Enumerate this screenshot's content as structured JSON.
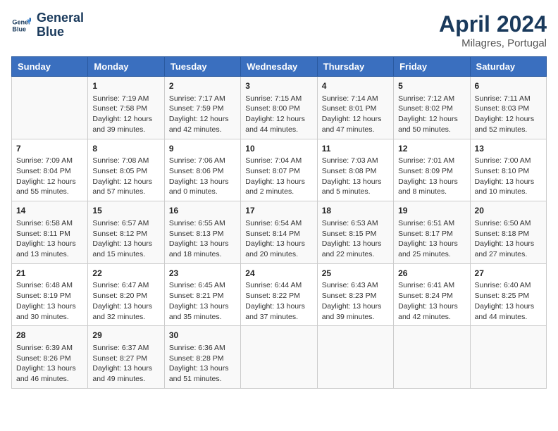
{
  "logo": {
    "line1": "General",
    "line2": "Blue"
  },
  "title": "April 2024",
  "subtitle": "Milagres, Portugal",
  "headers": [
    "Sunday",
    "Monday",
    "Tuesday",
    "Wednesday",
    "Thursday",
    "Friday",
    "Saturday"
  ],
  "weeks": [
    [
      {
        "day": "",
        "info": ""
      },
      {
        "day": "1",
        "info": "Sunrise: 7:19 AM\nSunset: 7:58 PM\nDaylight: 12 hours\nand 39 minutes."
      },
      {
        "day": "2",
        "info": "Sunrise: 7:17 AM\nSunset: 7:59 PM\nDaylight: 12 hours\nand 42 minutes."
      },
      {
        "day": "3",
        "info": "Sunrise: 7:15 AM\nSunset: 8:00 PM\nDaylight: 12 hours\nand 44 minutes."
      },
      {
        "day": "4",
        "info": "Sunrise: 7:14 AM\nSunset: 8:01 PM\nDaylight: 12 hours\nand 47 minutes."
      },
      {
        "day": "5",
        "info": "Sunrise: 7:12 AM\nSunset: 8:02 PM\nDaylight: 12 hours\nand 50 minutes."
      },
      {
        "day": "6",
        "info": "Sunrise: 7:11 AM\nSunset: 8:03 PM\nDaylight: 12 hours\nand 52 minutes."
      }
    ],
    [
      {
        "day": "7",
        "info": "Sunrise: 7:09 AM\nSunset: 8:04 PM\nDaylight: 12 hours\nand 55 minutes."
      },
      {
        "day": "8",
        "info": "Sunrise: 7:08 AM\nSunset: 8:05 PM\nDaylight: 12 hours\nand 57 minutes."
      },
      {
        "day": "9",
        "info": "Sunrise: 7:06 AM\nSunset: 8:06 PM\nDaylight: 13 hours\nand 0 minutes."
      },
      {
        "day": "10",
        "info": "Sunrise: 7:04 AM\nSunset: 8:07 PM\nDaylight: 13 hours\nand 2 minutes."
      },
      {
        "day": "11",
        "info": "Sunrise: 7:03 AM\nSunset: 8:08 PM\nDaylight: 13 hours\nand 5 minutes."
      },
      {
        "day": "12",
        "info": "Sunrise: 7:01 AM\nSunset: 8:09 PM\nDaylight: 13 hours\nand 8 minutes."
      },
      {
        "day": "13",
        "info": "Sunrise: 7:00 AM\nSunset: 8:10 PM\nDaylight: 13 hours\nand 10 minutes."
      }
    ],
    [
      {
        "day": "14",
        "info": "Sunrise: 6:58 AM\nSunset: 8:11 PM\nDaylight: 13 hours\nand 13 minutes."
      },
      {
        "day": "15",
        "info": "Sunrise: 6:57 AM\nSunset: 8:12 PM\nDaylight: 13 hours\nand 15 minutes."
      },
      {
        "day": "16",
        "info": "Sunrise: 6:55 AM\nSunset: 8:13 PM\nDaylight: 13 hours\nand 18 minutes."
      },
      {
        "day": "17",
        "info": "Sunrise: 6:54 AM\nSunset: 8:14 PM\nDaylight: 13 hours\nand 20 minutes."
      },
      {
        "day": "18",
        "info": "Sunrise: 6:53 AM\nSunset: 8:15 PM\nDaylight: 13 hours\nand 22 minutes."
      },
      {
        "day": "19",
        "info": "Sunrise: 6:51 AM\nSunset: 8:17 PM\nDaylight: 13 hours\nand 25 minutes."
      },
      {
        "day": "20",
        "info": "Sunrise: 6:50 AM\nSunset: 8:18 PM\nDaylight: 13 hours\nand 27 minutes."
      }
    ],
    [
      {
        "day": "21",
        "info": "Sunrise: 6:48 AM\nSunset: 8:19 PM\nDaylight: 13 hours\nand 30 minutes."
      },
      {
        "day": "22",
        "info": "Sunrise: 6:47 AM\nSunset: 8:20 PM\nDaylight: 13 hours\nand 32 minutes."
      },
      {
        "day": "23",
        "info": "Sunrise: 6:45 AM\nSunset: 8:21 PM\nDaylight: 13 hours\nand 35 minutes."
      },
      {
        "day": "24",
        "info": "Sunrise: 6:44 AM\nSunset: 8:22 PM\nDaylight: 13 hours\nand 37 minutes."
      },
      {
        "day": "25",
        "info": "Sunrise: 6:43 AM\nSunset: 8:23 PM\nDaylight: 13 hours\nand 39 minutes."
      },
      {
        "day": "26",
        "info": "Sunrise: 6:41 AM\nSunset: 8:24 PM\nDaylight: 13 hours\nand 42 minutes."
      },
      {
        "day": "27",
        "info": "Sunrise: 6:40 AM\nSunset: 8:25 PM\nDaylight: 13 hours\nand 44 minutes."
      }
    ],
    [
      {
        "day": "28",
        "info": "Sunrise: 6:39 AM\nSunset: 8:26 PM\nDaylight: 13 hours\nand 46 minutes."
      },
      {
        "day": "29",
        "info": "Sunrise: 6:37 AM\nSunset: 8:27 PM\nDaylight: 13 hours\nand 49 minutes."
      },
      {
        "day": "30",
        "info": "Sunrise: 6:36 AM\nSunset: 8:28 PM\nDaylight: 13 hours\nand 51 minutes."
      },
      {
        "day": "",
        "info": ""
      },
      {
        "day": "",
        "info": ""
      },
      {
        "day": "",
        "info": ""
      },
      {
        "day": "",
        "info": ""
      }
    ]
  ]
}
